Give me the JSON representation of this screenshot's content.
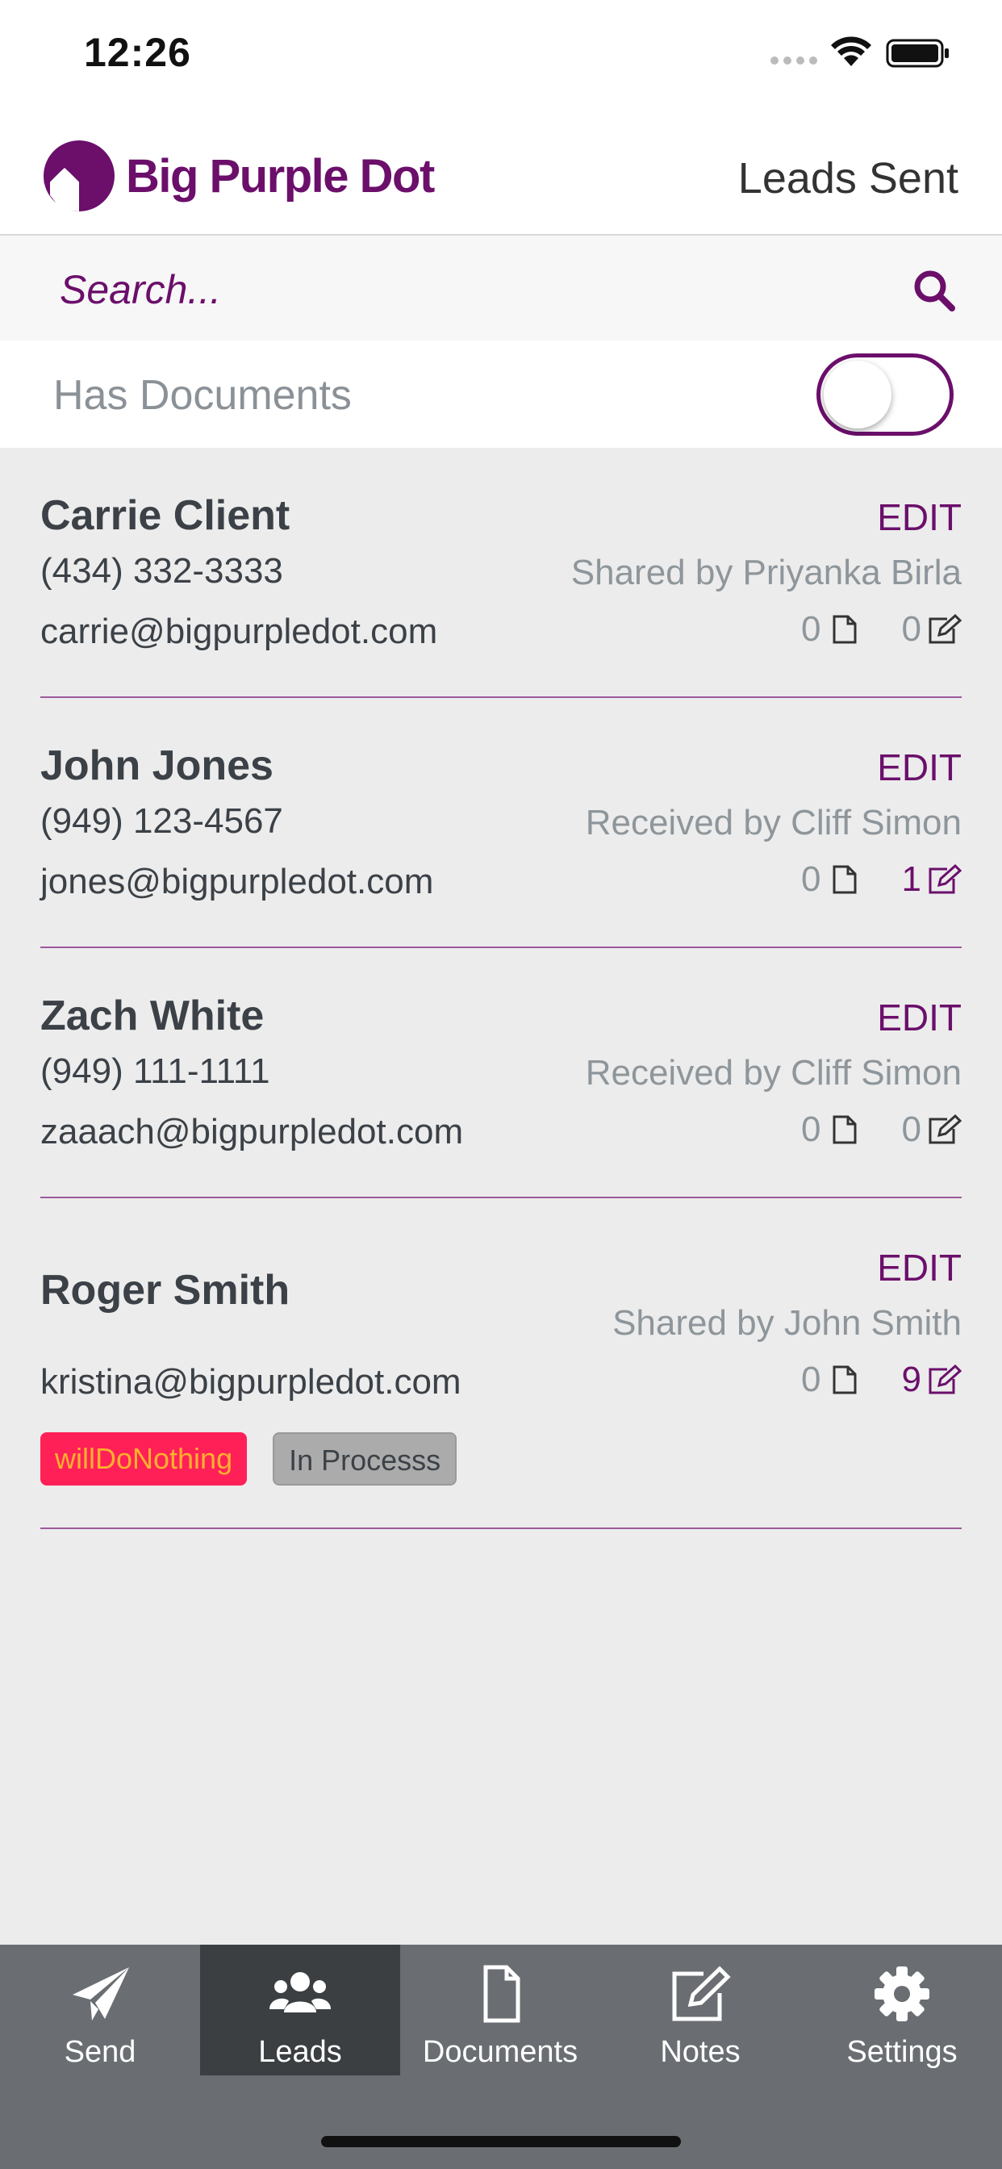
{
  "status": {
    "time": "12:26"
  },
  "header": {
    "brand": "Big Purple Dot",
    "title": "Leads Sent"
  },
  "search": {
    "placeholder": "Search..."
  },
  "filter": {
    "label": "Has Documents",
    "enabled": false
  },
  "colors": {
    "brand": "#6b0f6b",
    "tabbar": "#6a6e72",
    "tab_active": "#3b3f42",
    "tag_red": "#ff2057"
  },
  "leads": [
    {
      "name": "Carrie Client",
      "phone": "(434) 332-3333",
      "email": "carrie@bigpurpledot.com",
      "edit": "EDIT",
      "shared": "Shared by Priyanka Birla",
      "docs": "0",
      "notes": "0"
    },
    {
      "name": "John Jones",
      "phone": "(949) 123-4567",
      "email": "jones@bigpurpledot.com",
      "edit": "EDIT",
      "shared": "Received by Cliff Simon",
      "docs": "0",
      "notes": "1"
    },
    {
      "name": "Zach White",
      "phone": "(949) 111-1111",
      "email": "zaaach@bigpurpledot.com",
      "edit": "EDIT",
      "shared": "Received by Cliff Simon",
      "docs": "0",
      "notes": "0"
    },
    {
      "name": "Roger Smith",
      "phone": "",
      "email": "kristina@bigpurpledot.com",
      "edit": "EDIT",
      "shared": "Shared by John Smith",
      "docs": "0",
      "notes": "9",
      "tags": [
        "willDoNothing",
        "In Processs"
      ]
    }
  ],
  "tabs": [
    {
      "label": "Send",
      "icon": "paper-plane-icon"
    },
    {
      "label": "Leads",
      "icon": "users-icon",
      "active": true
    },
    {
      "label": "Documents",
      "icon": "document-icon"
    },
    {
      "label": "Notes",
      "icon": "edit-icon"
    },
    {
      "label": "Settings",
      "icon": "gear-icon"
    }
  ]
}
